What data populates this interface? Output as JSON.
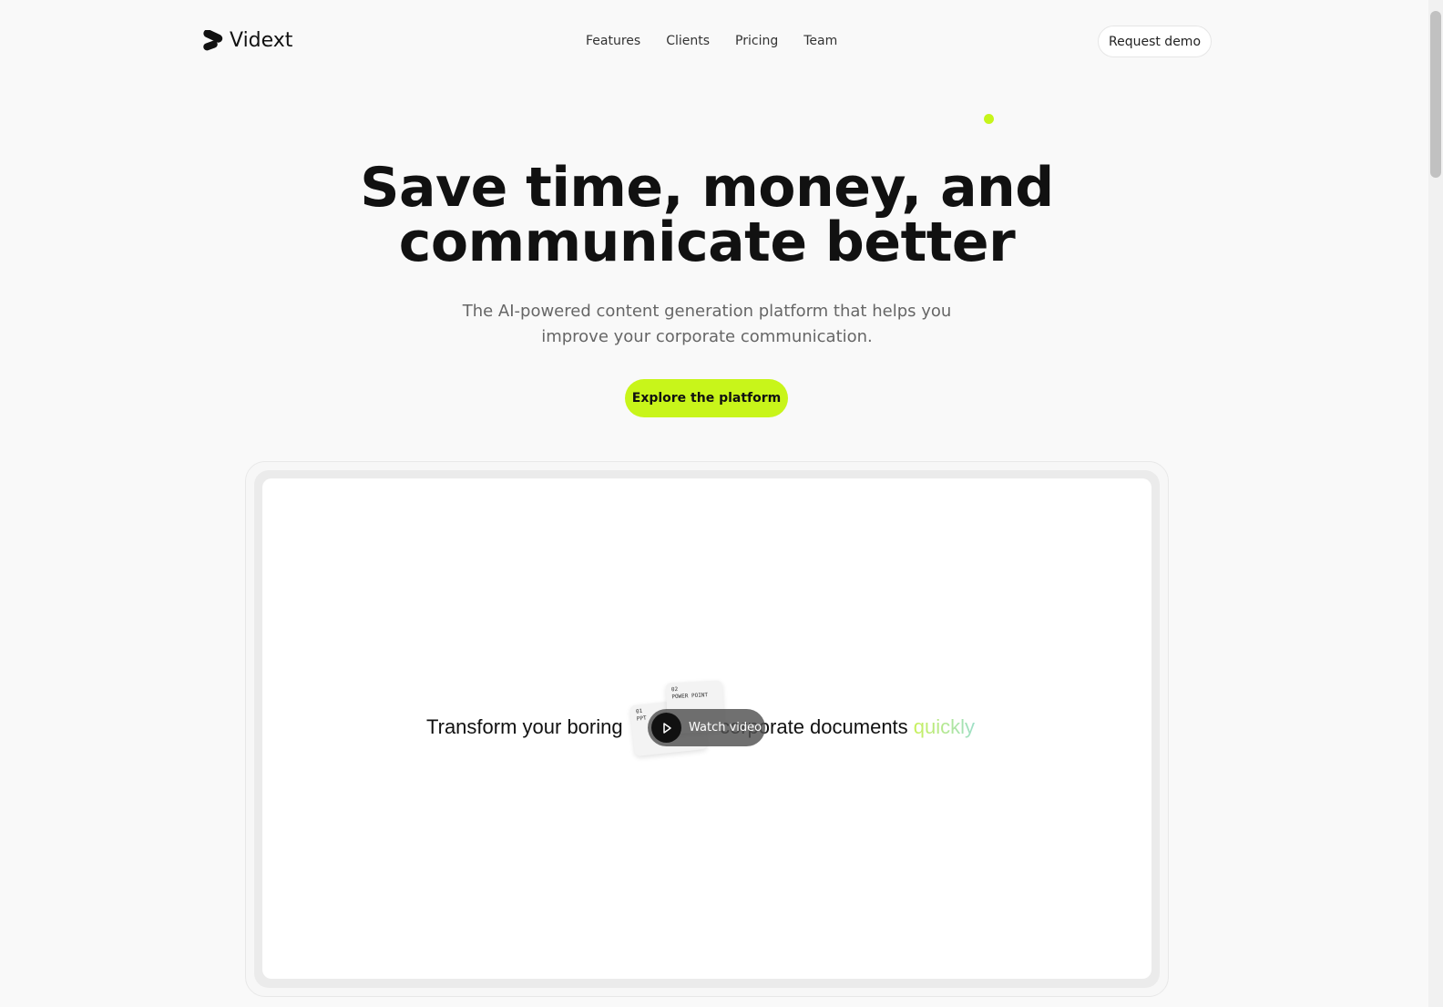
{
  "brand": {
    "name": "Vidext"
  },
  "nav": {
    "links": [
      "Features",
      "Clients",
      "Pricing",
      "Team"
    ],
    "request_demo": "Request demo"
  },
  "hero": {
    "title_line1": "Save time, money, and",
    "title_line2": "communicate better",
    "subtitle_line1": "The AI-powered content generation platform that helps you",
    "subtitle_line2": "improve your corporate communication.",
    "cta": "Explore the platform"
  },
  "video": {
    "text_before": "Transform your boring",
    "text_after": "corporate documents",
    "highlight": "quickly",
    "card1_num": "01",
    "card1_label": "PPT",
    "card2_num": "02",
    "card2_label": "POWER POINT",
    "watch_label": "Watch video"
  },
  "colors": {
    "accent": "#c8f51a",
    "background": "#f9f9f9"
  }
}
